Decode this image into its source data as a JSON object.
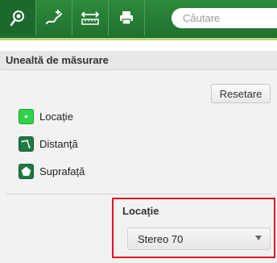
{
  "toolbar": {
    "buttons": [
      {
        "name": "location-pin-icon"
      },
      {
        "name": "route-icon"
      },
      {
        "name": "ruler-icon"
      },
      {
        "name": "print-icon"
      }
    ],
    "search_placeholder": "Căutare",
    "colors": {
      "toolbar_bg": "#2e8b3a",
      "accent": "#b8d77a"
    }
  },
  "panel": {
    "title": "Unealtă de măsurare",
    "reset_label": "Resetare",
    "tools": [
      {
        "label": "Locație",
        "icon": "point-icon"
      },
      {
        "label": "Distanță",
        "icon": "line-icon"
      },
      {
        "label": "Suprafață",
        "icon": "polygon-icon"
      }
    ],
    "settings": {
      "title": "Locație",
      "projection_value": "Stereo 70"
    },
    "highlight_color": "#e0141e"
  }
}
